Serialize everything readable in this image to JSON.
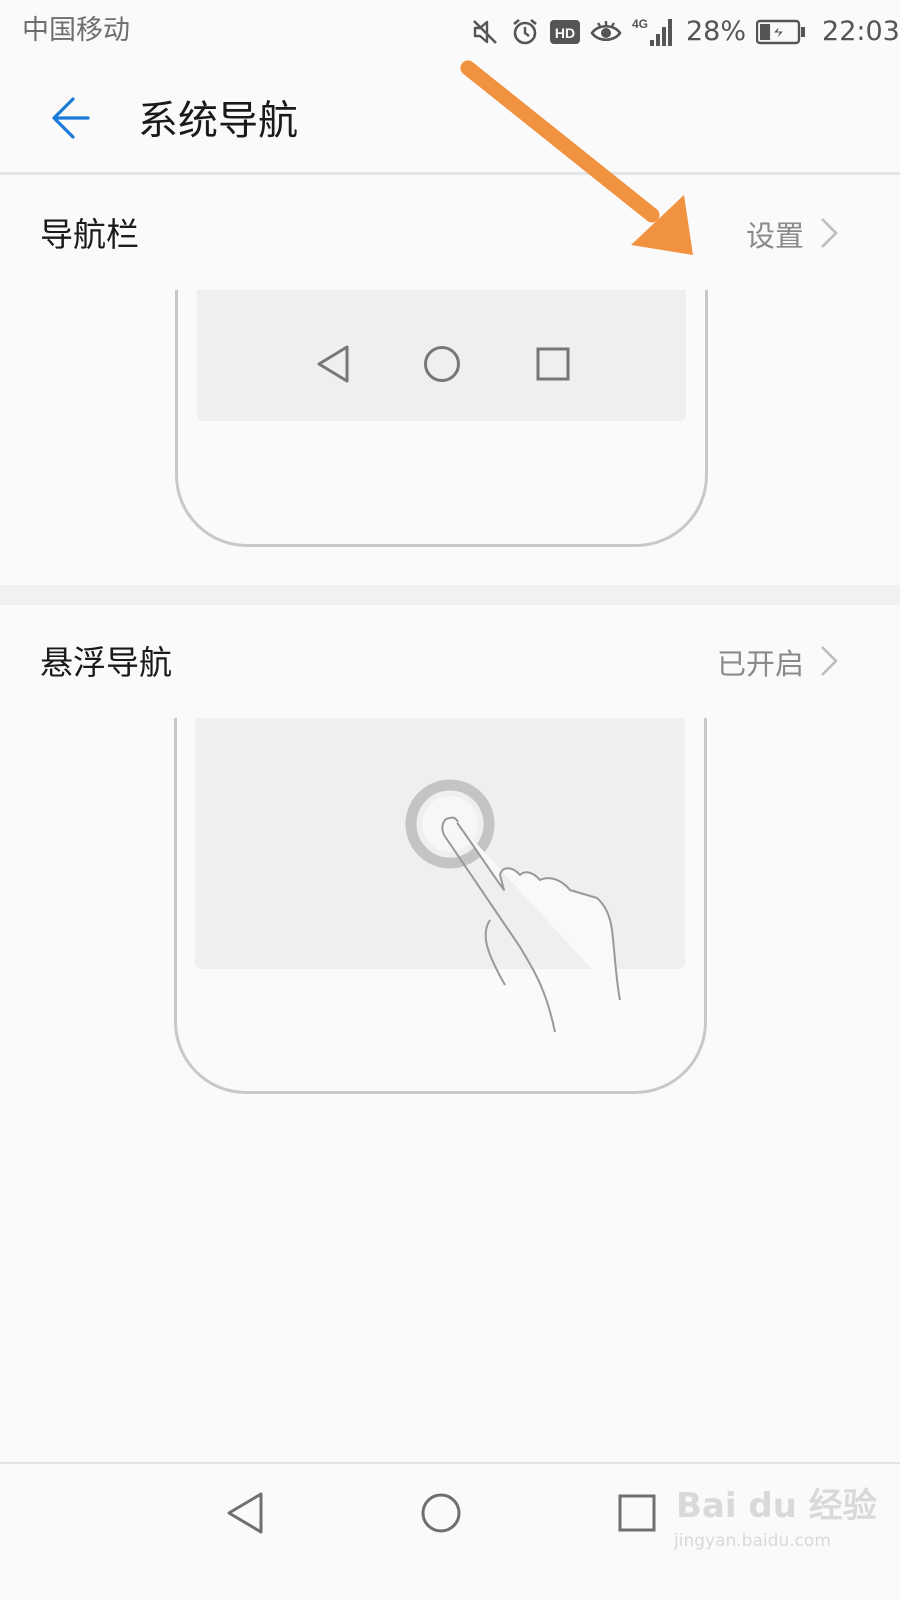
{
  "status_bar": {
    "carrier": "中国移动",
    "network_type": "4G",
    "battery_percent": "28%",
    "battery_level": 0.28,
    "time": "22:03",
    "icons": [
      "mute-icon",
      "alarm-icon",
      "hd-icon",
      "eye-comfort-icon",
      "signal-icon",
      "battery-charging-icon"
    ]
  },
  "header": {
    "back_icon": "arrow-left-icon",
    "title": "系统导航",
    "accent_color": "#1a7ad9"
  },
  "sections": [
    {
      "title": "导航栏",
      "value": "设置"
    },
    {
      "title": "悬浮导航",
      "value": "已开启"
    }
  ],
  "annotation": {
    "arrow_color": "#f0923f"
  },
  "system_nav": {
    "icons": [
      "back-triangle-icon",
      "home-circle-icon",
      "recents-square-icon"
    ]
  },
  "watermark": {
    "brand": "Bai du 经验",
    "url": "jingyan.baidu.com"
  }
}
